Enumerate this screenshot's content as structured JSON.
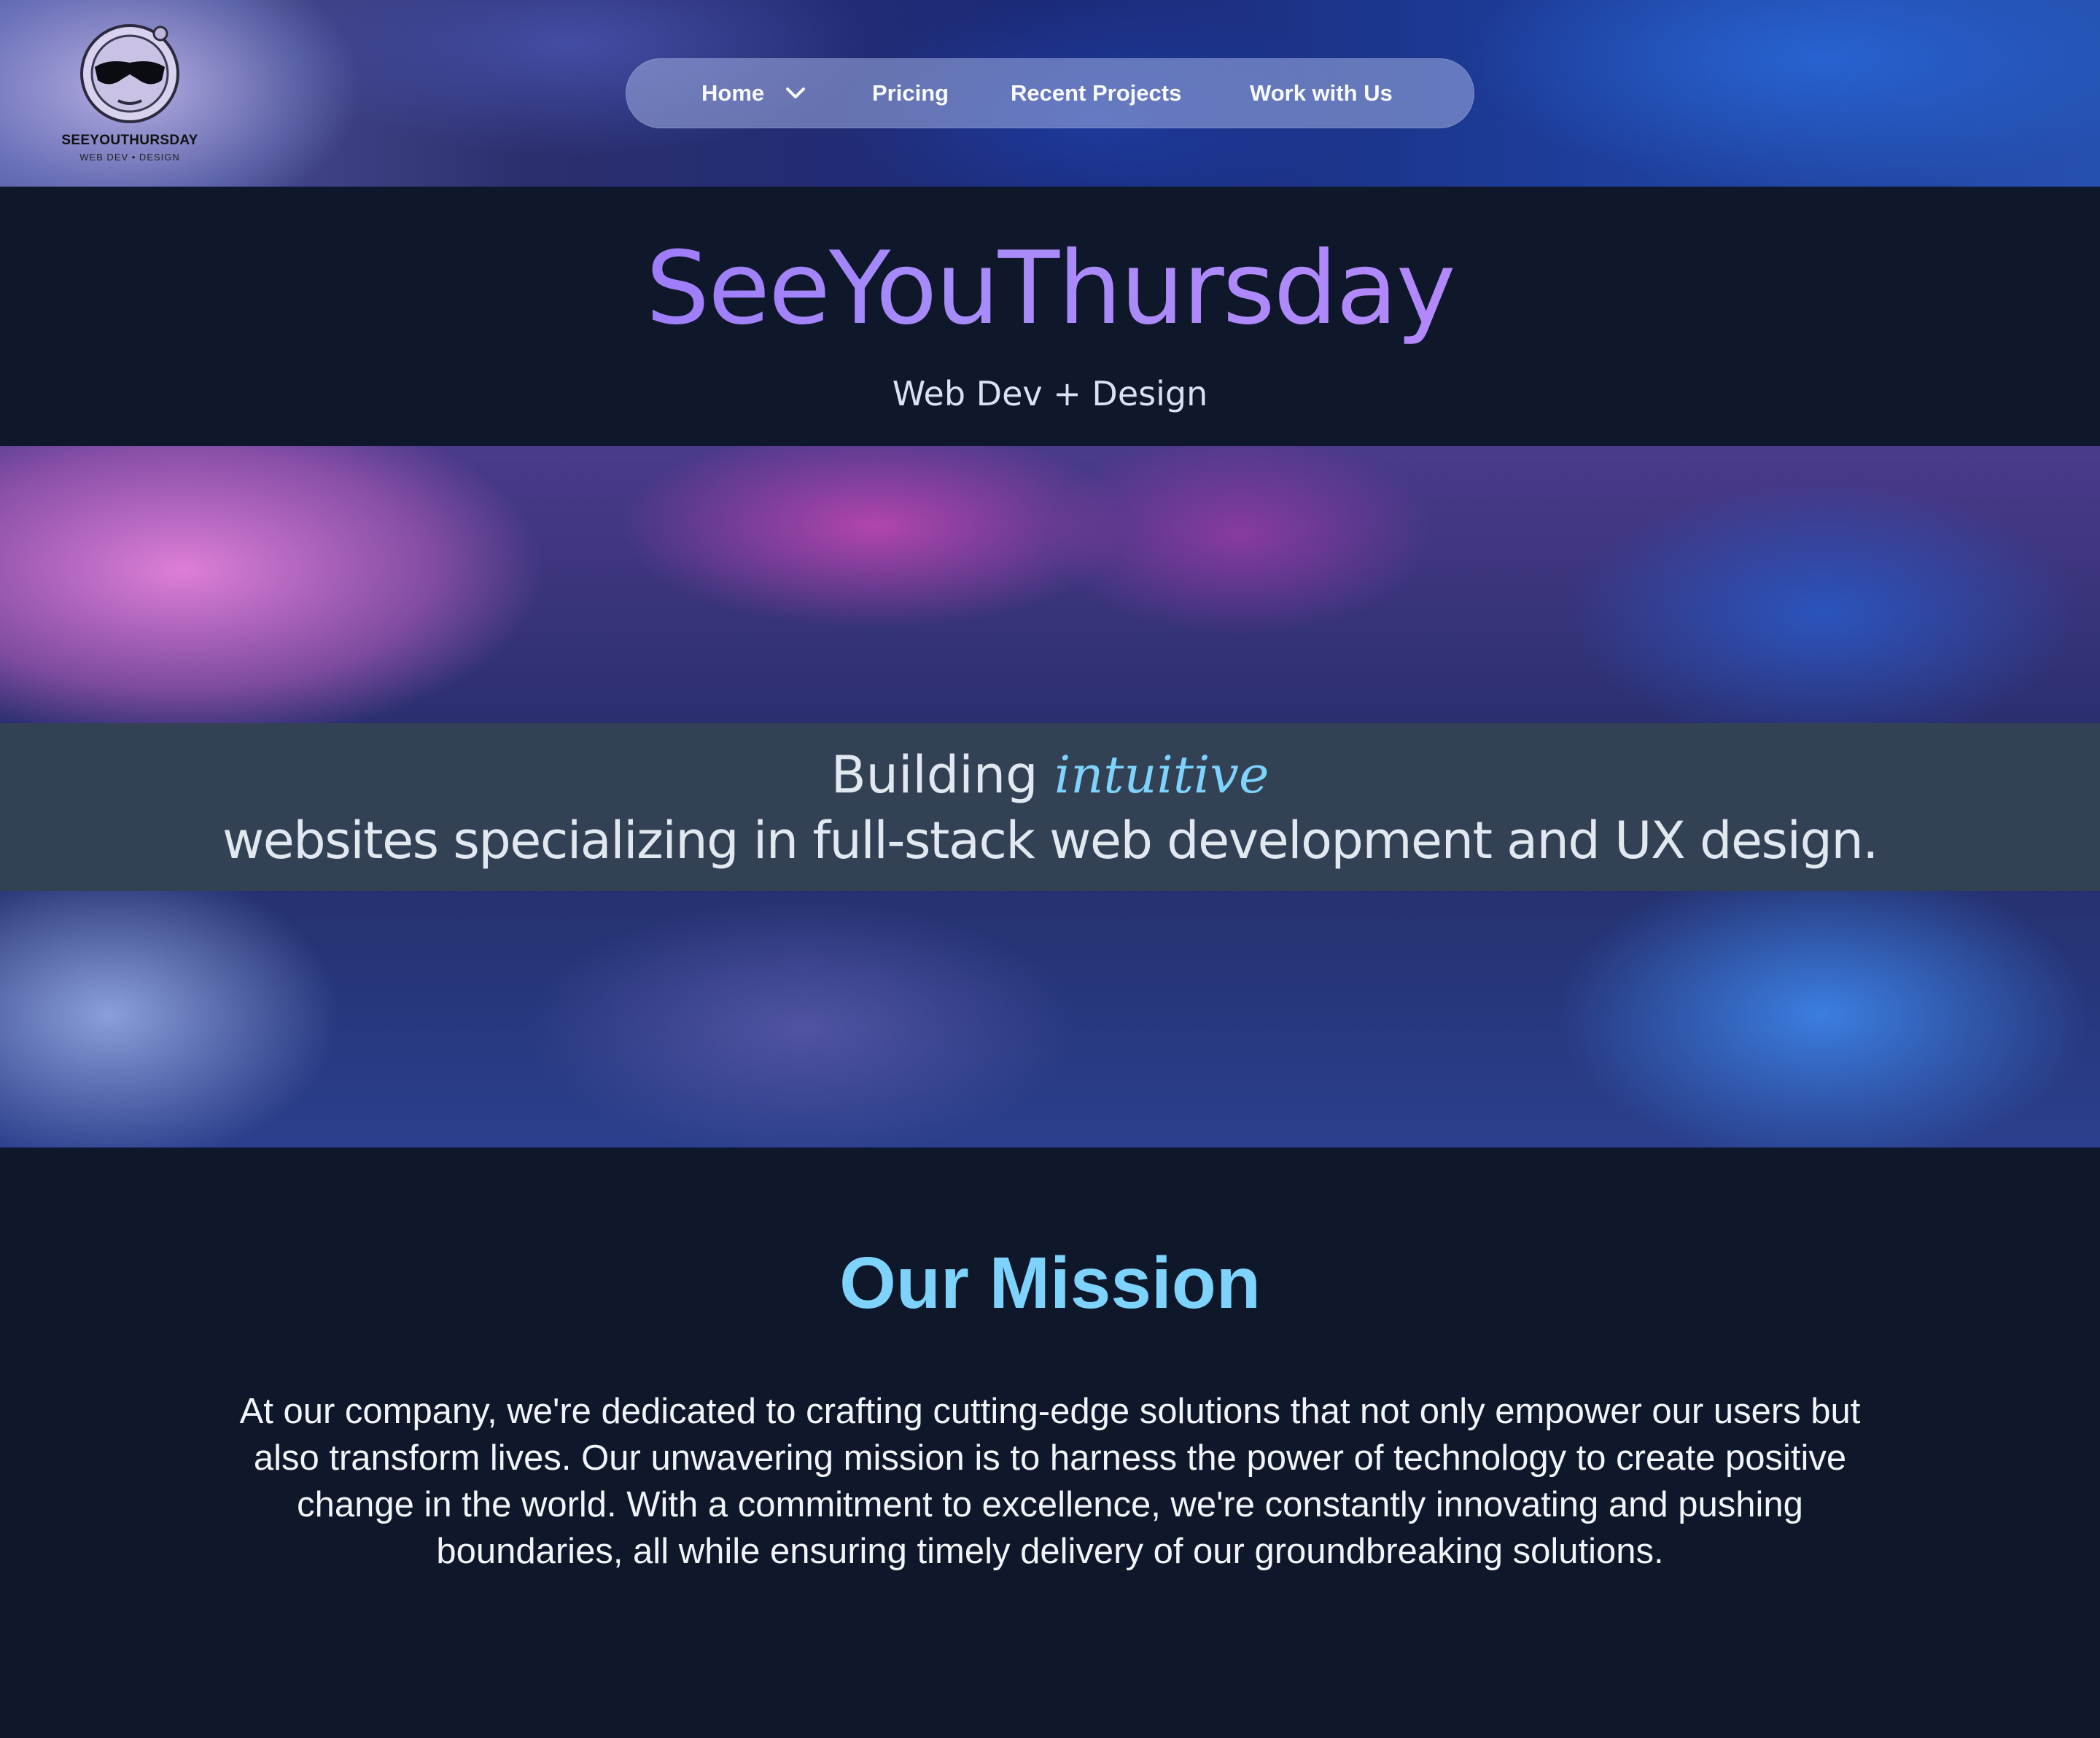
{
  "brand": {
    "logo_title": "SEEYOUTHURSDAY",
    "logo_subtitle": "WEB DEV • DESIGN"
  },
  "nav": {
    "items": [
      {
        "label": "Home",
        "has_dropdown": true
      },
      {
        "label": "Pricing"
      },
      {
        "label": "Recent Projects"
      },
      {
        "label": "Work with Us"
      }
    ]
  },
  "hero": {
    "title": "SeeYouThursday",
    "subtitle": "Web Dev + Design",
    "tagline_prefix": "Building",
    "tagline_emphasis": "intuitive",
    "tagline_rest": "websites specializing in full-stack web development and UX design."
  },
  "mission": {
    "heading": "Our Mission",
    "body": "At our company, we're dedicated to crafting cutting-edge solutions that not only empower our users but also transform lives. Our unwavering mission is to harness the power of technology to create positive change in the world. With a commitment to excellence, we're constantly innovating and pushing boundaries, all while ensuring timely delivery of our groundbreaking solutions."
  },
  "colors": {
    "background": "#0f172a",
    "tagline_band": "#334155",
    "accent_blue": "#7dd3fc",
    "title_gradient_start": "#8b5cf6",
    "title_gradient_end": "#c084fc"
  },
  "icons": [
    "astronaut-logo-icon",
    "chevron-down-icon"
  ]
}
